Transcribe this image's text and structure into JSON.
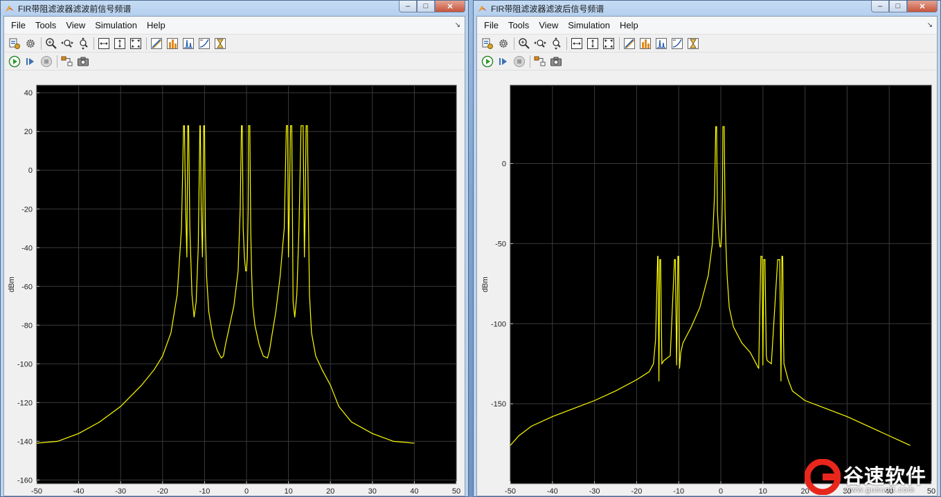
{
  "windows": [
    {
      "id": "left",
      "title": "FIR带阻滤波器滤波前信号频谱",
      "menus": [
        "File",
        "Tools",
        "View",
        "Simulation",
        "Help"
      ],
      "controls": {
        "minimize": "–",
        "maximize": "□",
        "close": "✕"
      },
      "toolbar1": [
        "configuration-icon",
        "settings-icon",
        "sep",
        "zoom-in-icon",
        "zoom-x-icon",
        "zoom-y-icon",
        "sep",
        "scale-xy-icon",
        "scale-y-icon",
        "scale-x-icon",
        "sep",
        "cursor-measure-icon",
        "peak-finder-icon",
        "spectrum-measure-icon",
        "distortion-icon",
        "ccdf-icon"
      ],
      "toolbar2": [
        "run-icon",
        "step-forward-icon",
        "stop-icon",
        "sep",
        "highlight-block-icon",
        "snapshot-icon"
      ],
      "chart_data": {
        "type": "line",
        "ylabel": "dBm",
        "xlim": [
          -50,
          50
        ],
        "ylim": [
          -162,
          44
        ],
        "xticks": [
          -50,
          -40,
          -30,
          -20,
          -10,
          0,
          10,
          20,
          30,
          40,
          50
        ],
        "yticks": [
          40,
          20,
          0,
          -20,
          -40,
          -60,
          -80,
          -100,
          -120,
          -140,
          -160
        ],
        "grid": true,
        "line_color": "#ffff00",
        "series": [
          {
            "x": [
              -50,
              -45,
              -40,
              -35,
              -30,
              -25,
              -22,
              -20,
              -18,
              -16.5,
              -15.5,
              -15,
              -14.8,
              -14.5,
              -14.2,
              -14,
              -13.8,
              -13.5,
              -13,
              -12.5,
              -12,
              -11.5,
              -11.1,
              -11,
              -10.8,
              -10.5,
              -10.2,
              -10,
              -9.8,
              -9.5,
              -9,
              -8,
              -7,
              -6,
              -5.5,
              -5,
              -4,
              -3,
              -2,
              -1.5,
              -1.2,
              -1,
              -0.8,
              -0.5,
              -0.2,
              0,
              0.2,
              0.4,
              0.5,
              0.8,
              1,
              1.2,
              1.5,
              2,
              3,
              4,
              5,
              5.5,
              6,
              7,
              8,
              9,
              9.5,
              9.8,
              10,
              10.2,
              10.5,
              10.8,
              11,
              11.1,
              11.5,
              12,
              12.5,
              13,
              13.5,
              13.8,
              14,
              14.2,
              14.5,
              14.8,
              15,
              15.5,
              16.5,
              18,
              20,
              22,
              25,
              30,
              35,
              40,
              45,
              50
            ],
            "y": [
              -141,
              -140,
              -136,
              -130,
              -122,
              -111,
              -103,
              -96,
              -84,
              -64,
              -30,
              23,
              23,
              -20,
              -45,
              23,
              23,
              -30,
              -64,
              -76,
              -68,
              -40,
              23,
              23,
              -20,
              -45,
              23,
              23,
              -30,
              -55,
              -73,
              -86,
              -93,
              -97,
              -96,
              -90,
              -80,
              -70,
              -52,
              -20,
              23,
              23,
              -30,
              -45,
              -52,
              -52,
              -45,
              -20,
              23,
              23,
              -30,
              -52,
              -70,
              -80,
              -90,
              -96,
              -97,
              -93,
              -86,
              -73,
              -55,
              -30,
              23,
              23,
              -45,
              -20,
              23,
              23,
              -40,
              -68,
              -76,
              -64,
              -30,
              23,
              23,
              -45,
              -20,
              23,
              23,
              -30,
              -64,
              -84,
              -96,
              -103,
              -111,
              -122,
              -130,
              -136,
              -140,
              -141
            ]
          }
        ]
      }
    },
    {
      "id": "right",
      "title": "FIR带阻滤波器滤波后信号频谱",
      "menus": [
        "File",
        "Tools",
        "View",
        "Simulation",
        "Help"
      ],
      "controls": {
        "minimize": "–",
        "maximize": "□",
        "close": "✕"
      },
      "toolbar1": [
        "configuration-icon",
        "settings-icon",
        "sep",
        "zoom-in-icon",
        "zoom-x-icon",
        "zoom-y-icon",
        "sep",
        "scale-xy-icon",
        "scale-y-icon",
        "scale-x-icon",
        "sep",
        "cursor-measure-icon",
        "peak-finder-icon",
        "spectrum-measure-icon",
        "distortion-icon",
        "ccdf-icon"
      ],
      "toolbar2": [
        "run-icon",
        "step-forward-icon",
        "stop-icon",
        "sep",
        "highlight-block-icon",
        "snapshot-icon"
      ],
      "chart_data": {
        "type": "line",
        "ylabel": "dBm",
        "xlim": [
          -50,
          50
        ],
        "ylim": [
          -200,
          49
        ],
        "xticks": [
          -50,
          -40,
          -30,
          -20,
          -10,
          0,
          10,
          20,
          30,
          40,
          50
        ],
        "yticks": [
          0,
          -50,
          -100,
          -150
        ],
        "grid": true,
        "line_color": "#ffff00",
        "series": [
          {
            "x": [
              -50,
              -48,
              -45,
              -40,
              -35,
              -30,
              -25,
              -20,
              -17,
              -16,
              -15.5,
              -15,
              -14.9,
              -14.7,
              -14.5,
              -14.3,
              -14,
              -13.5,
              -12,
              -11,
              -10.8,
              -10.5,
              -10.2,
              -10,
              -9.8,
              -9.5,
              -9,
              -7,
              -5,
              -3,
              -2,
              -1.5,
              -1.2,
              -1,
              -0.8,
              -0.5,
              -0.2,
              0,
              0.2,
              0.4,
              0.5,
              0.8,
              1,
              1.2,
              1.5,
              2,
              3,
              5,
              7,
              9,
              9.5,
              9.8,
              10,
              10.2,
              10.5,
              10.8,
              11,
              12,
              13.5,
              14,
              14.3,
              14.5,
              14.7,
              14.9,
              15,
              15.5,
              16,
              17,
              20,
              25,
              30,
              35,
              40,
              45,
              48,
              50
            ],
            "y": [
              -176,
              -170,
              -164,
              -158,
              -153,
              -148,
              -142,
              -135,
              -130,
              -125,
              -110,
              -58,
              -58,
              -136,
              -60,
              -60,
              -125,
              -123,
              -120,
              -60,
              -60,
              -126,
              -58,
              -58,
              -128,
              -118,
              -112,
              -102,
              -90,
              -70,
              -50,
              -20,
              23,
              23,
              -30,
              -45,
              -52,
              -52,
              -45,
              -20,
              23,
              23,
              -30,
              -50,
              -70,
              -90,
              -102,
              -112,
              -118,
              -128,
              -58,
              -58,
              -126,
              -60,
              -60,
              -120,
              -123,
              -125,
              -60,
              -60,
              -136,
              -58,
              -58,
              -110,
              -125,
              -130,
              -135,
              -142,
              -148,
              -153,
              -158,
              -164,
              -170,
              -176
            ]
          }
        ]
      }
    }
  ],
  "watermark": {
    "text": "谷速软件",
    "url": "www.gusuoft.com"
  }
}
